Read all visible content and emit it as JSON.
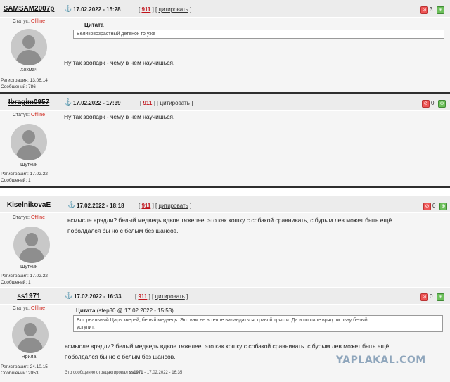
{
  "labels": {
    "status": "Статус:",
    "offline": "Offline",
    "registration": "Регистрация:",
    "messages": "Сообщений:",
    "cite": "цитировать",
    "quote": "Цитата",
    "edited_prefix": "Это сообщение отредактировал",
    "edited_sep": " - "
  },
  "posts": [
    {
      "user": "SAMSAM2007p",
      "rank": "Хохмач",
      "reg": "13.06.14",
      "count": "786",
      "date": "17.02.2022 - 15:28",
      "num": "911",
      "minus": "⊘",
      "rating": "3",
      "plus": "⊕",
      "quote_text": "Великовозрастный детёнок то уже",
      "message": "Ну так зоопарк - чему в нем научишься."
    },
    {
      "user": "Ibragim0957",
      "rank": "Шутник",
      "reg": "17.02.22",
      "count": "1",
      "date": "17.02.2022 - 17:39",
      "num": "911",
      "minus": "⊘",
      "rating": "0",
      "plus": "⊕",
      "message": "Ну так зоопарк - чему в нем научишься."
    },
    {
      "user": "KiselnikovaE",
      "rank": "Шутник",
      "reg": "17.02.22",
      "count": "1",
      "date": "17.02.2022 - 18:18",
      "num": "911",
      "minus": "⊘",
      "rating": "0",
      "plus": "⊕",
      "message_line1": "всмысле врядли? белый медведь вдвое тяжелее. это как кошку с собакой сравнивать, с бурым лев может быть ещё",
      "message_line2": "поболдался бы но с белым без шансов."
    },
    {
      "user": "ss1971",
      "rank": "Ярила",
      "reg": "24.10.15",
      "count": "2053",
      "date": "17.02.2022 - 16:33",
      "num": "911",
      "minus": "⊘",
      "rating": "0",
      "plus": "⊕",
      "quote_source": "(step30 @ 17.02.2022 - 15:53)",
      "quote_line1": "Вот реальный Царь зверей, белый медведь. Это вам не в тепле валандаться, гривой трясти. Да и по силе вряд ли льву белый",
      "quote_line2": "уступит.",
      "message_line1": "всмысле врядли? белый медведь вдвое тяжелее. это как кошку с собакой сравнивать. с бурым лев может быть ещё",
      "message_line2": "поболдался бы но с белым без шансов.",
      "edited_by": "ss1971",
      "edited_date": "17.02.2022 - 16:35"
    }
  ],
  "watermark": "YAPLAKAL.COM"
}
